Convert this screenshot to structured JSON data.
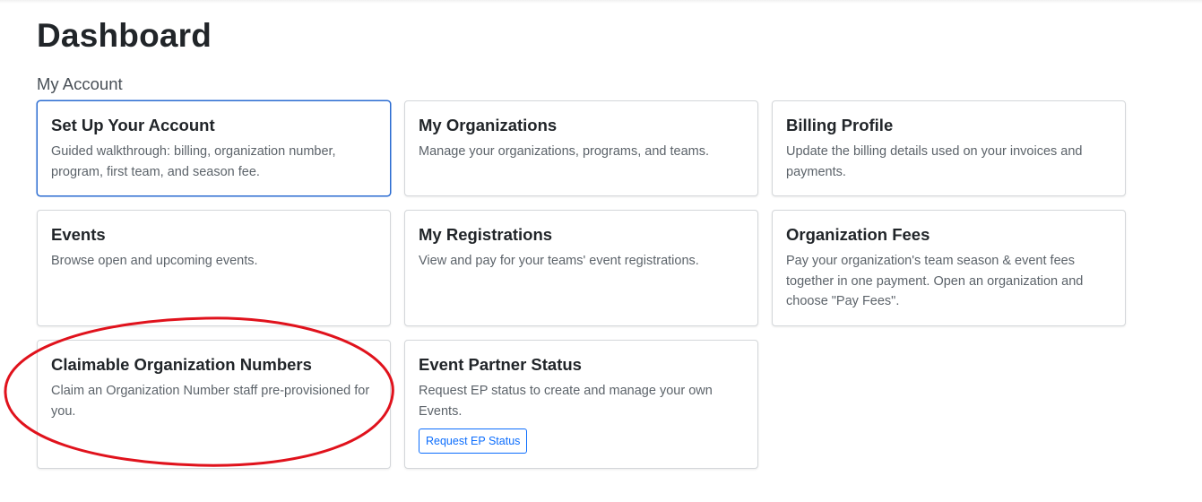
{
  "page": {
    "title": "Dashboard",
    "section_title": "My Account"
  },
  "cards": [
    {
      "title": "Set Up Your Account",
      "text": "Guided walkthrough: billing, organization number, program, first team, and season fee."
    },
    {
      "title": "My Organizations",
      "text": "Manage your organizations, programs, and teams."
    },
    {
      "title": "Billing Profile",
      "text": "Update the billing details used on your invoices and payments."
    },
    {
      "title": "Events",
      "text": "Browse open and upcoming events."
    },
    {
      "title": "My Registrations",
      "text": "View and pay for your teams' event registrations."
    },
    {
      "title": "Organization Fees",
      "text": "Pay your organization's team season & event fees together in one payment. Open an organization and choose \"Pay Fees\"."
    },
    {
      "title": "Claimable Organization Numbers",
      "text": "Claim an Organization Number staff pre-provisioned for you."
    },
    {
      "title": "Event Partner Status",
      "text": "Request EP status to create and manage your own Events.",
      "button_label": "Request EP Status"
    }
  ],
  "colors": {
    "accent": "#0d6efd",
    "active_border": "#2a6bd1",
    "annotation": "#e0121c"
  }
}
